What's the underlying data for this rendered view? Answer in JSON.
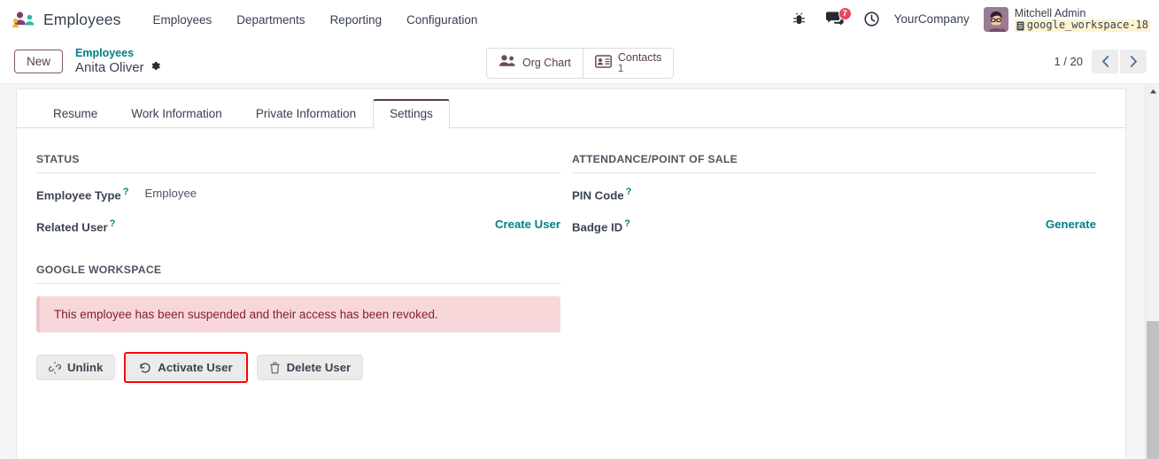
{
  "navbar": {
    "brand": "Employees",
    "brand_icon": "employees-app-icon",
    "menu": [
      {
        "label": "Employees",
        "name": "employees"
      },
      {
        "label": "Departments",
        "name": "departments"
      },
      {
        "label": "Reporting",
        "name": "reporting"
      },
      {
        "label": "Configuration",
        "name": "configuration"
      }
    ],
    "sys_icons": [
      {
        "name": "bug-icon"
      },
      {
        "name": "messages-icon",
        "badge": "7"
      },
      {
        "name": "activities-clock-icon"
      }
    ],
    "company": "YourCompany",
    "user": {
      "name": "Mitchell Admin",
      "database": "google_workspace-18",
      "db_icon": "database-icon",
      "avatar": "user-avatar"
    }
  },
  "control_panel": {
    "new_button": "New",
    "breadcrumb_parent": "Employees",
    "breadcrumb_current": "Anita Oliver",
    "settings_icon": "gear-icon",
    "stat_buttons": [
      {
        "label": "Org Chart",
        "value": "",
        "icon": "org-chart-users-icon"
      },
      {
        "label": "Contacts",
        "value": "1",
        "icon": "contact-card-icon"
      }
    ],
    "pager": {
      "count": "1 / 20",
      "prev_icon": "chevron-left-icon",
      "next_icon": "chevron-right-icon"
    }
  },
  "tabs": [
    {
      "label": "Resume",
      "active": false
    },
    {
      "label": "Work Information",
      "active": false
    },
    {
      "label": "Private Information",
      "active": false
    },
    {
      "label": "Settings",
      "active": true
    }
  ],
  "settings": {
    "status_group": {
      "title": "STATUS",
      "fields": [
        {
          "label": "Employee Type",
          "help": "?",
          "value": "Employee",
          "action": ""
        },
        {
          "label": "Related User",
          "help": "?",
          "value": "",
          "action": "Create User"
        }
      ]
    },
    "attendance_group": {
      "title": "ATTENDANCE/POINT OF SALE",
      "fields": [
        {
          "label": "PIN Code",
          "help": "?",
          "value": "",
          "action": ""
        },
        {
          "label": "Badge ID",
          "help": "?",
          "value": "",
          "action": "Generate"
        }
      ]
    },
    "google_workspace": {
      "title": "GOOGLE WORKSPACE",
      "alert": "This employee has been suspended and their access has been revoked.",
      "buttons": [
        {
          "label": "Unlink",
          "icon": "unlink-icon",
          "highlighted": false
        },
        {
          "label": "Activate User",
          "icon": "undo-rotate-left-icon",
          "highlighted": true
        },
        {
          "label": "Delete User",
          "icon": "trash-icon",
          "highlighted": false
        }
      ]
    }
  },
  "colors": {
    "accent": "#017e84",
    "brand_purple": "#5a3a4d",
    "alert_bg": "#f8d7da",
    "alert_text": "#842029",
    "badge_red": "#e6475f",
    "highlight_red": "#ff0000"
  },
  "scrollbar": {
    "up_arrow": "scroll-up-arrow"
  }
}
